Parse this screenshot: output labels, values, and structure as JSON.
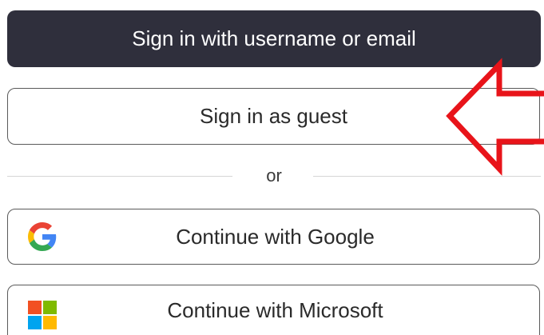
{
  "buttons": {
    "primary": {
      "label": "Sign in with username or email"
    },
    "guest": {
      "label": "Sign in as guest"
    },
    "google": {
      "label": "Continue with Google",
      "icon": "google-logo-icon"
    },
    "microsoft": {
      "label": "Continue with Microsoft",
      "icon": "microsoft-logo-icon"
    }
  },
  "divider": {
    "text": "or"
  },
  "annotation": {
    "arrow": "red-arrow-icon",
    "color": "#e8141a"
  },
  "colors": {
    "primary_bg": "#2f2f3c",
    "primary_text": "#ffffff",
    "outline_border": "#5a5a5a",
    "google": [
      "#4285F4",
      "#EA4335",
      "#FBBC05",
      "#34A853"
    ],
    "microsoft": [
      "#F25022",
      "#7FBA00",
      "#00A4EF",
      "#FFB900"
    ]
  }
}
